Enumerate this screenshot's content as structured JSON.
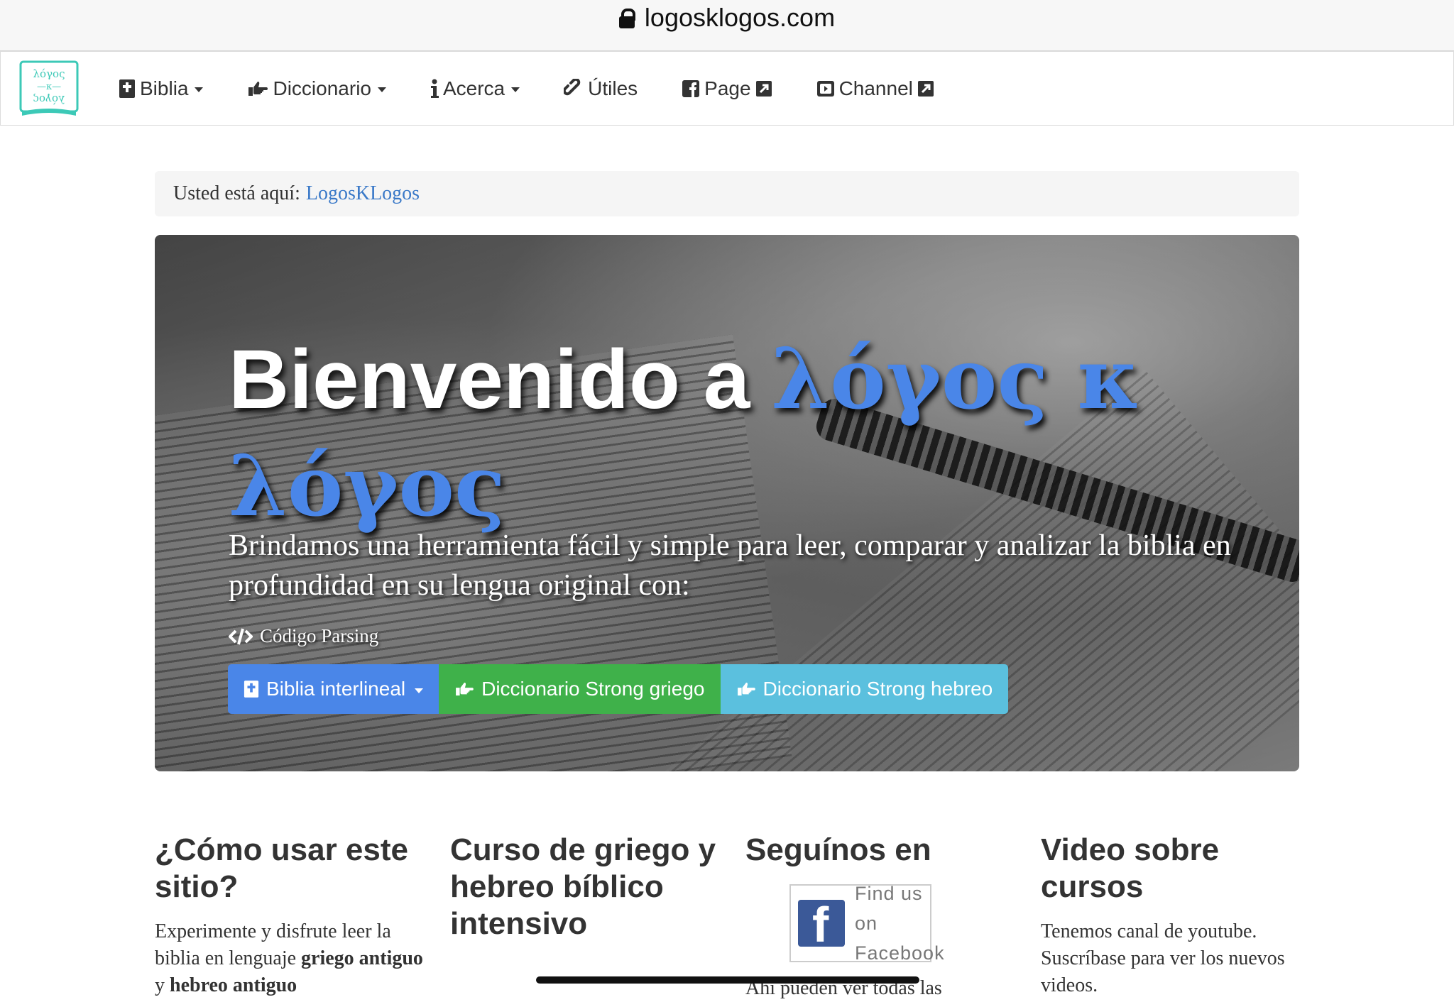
{
  "browser": {
    "url": "logosklogos.com"
  },
  "nav": {
    "brand_alt": "λόγος κ λόγος",
    "items": [
      {
        "label": "Biblia",
        "icon": "bible-icon",
        "dropdown": true
      },
      {
        "label": "Diccionario",
        "icon": "pointing-hand-icon",
        "dropdown": true
      },
      {
        "label": "Acerca",
        "icon": "info-icon",
        "dropdown": true
      },
      {
        "label": "Útiles",
        "icon": "link-icon",
        "dropdown": false
      },
      {
        "label": "Page",
        "icon": "facebook-icon",
        "external": true
      },
      {
        "label": "Channel",
        "icon": "youtube-icon",
        "external": true
      }
    ]
  },
  "breadcrumb": {
    "prefix": "Usted está aquí:",
    "link": "LogosKLogos"
  },
  "hero": {
    "title_plain": "Bienvenido a",
    "title_greek": "λόγος κ λόγος",
    "lead": "Brindamos una herramienta fácil y simple para leer, comparar y analizar la biblia en profundidad en su lengua original con:",
    "feature": "Código Parsing",
    "buttons": [
      {
        "label": "Biblia interlineal",
        "color": "#4a86e8"
      },
      {
        "label": "Diccionario Strong griego",
        "color": "#3fb14a"
      },
      {
        "label": "Diccionario Strong hebreo",
        "color": "#5bc0de"
      }
    ]
  },
  "columns": [
    {
      "title": "¿Cómo usar este sitio?",
      "text_start": "Experimente y disfrute leer la biblia en lenguaje ",
      "text_bold1": "griego antiguo",
      "text_mid": " y ",
      "text_bold2": "hebreo antiguo"
    },
    {
      "title": "Curso de griego y hebreo bíblico intensivo"
    },
    {
      "title": "Seguínos en",
      "text": "Ahí pueden ver todas las",
      "badge": "Find us on Facebook"
    },
    {
      "title": "Video sobre cursos",
      "text": "Tenemos canal de youtube. Suscríbase para ver los nuevos videos."
    }
  ],
  "colors": {
    "accent": "#4a86e8",
    "link": "#3a79c8",
    "facebook": "#3b5998"
  }
}
